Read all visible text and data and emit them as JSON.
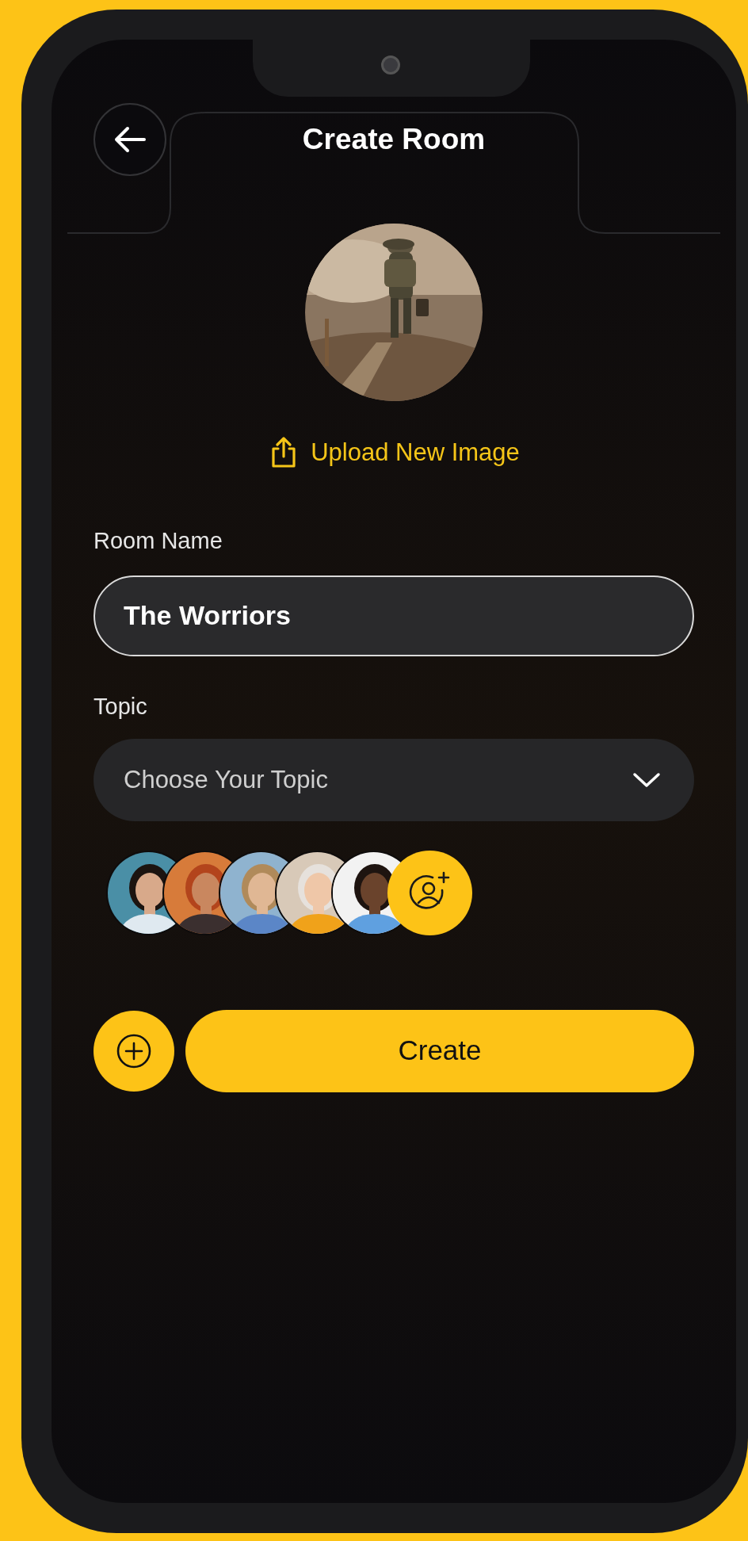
{
  "header": {
    "title": "Create Room"
  },
  "upload_link": "Upload New Image",
  "room_name": {
    "label": "Room Name",
    "value": "The Worriors"
  },
  "topic": {
    "label": "Topic",
    "placeholder": "Choose Your Topic"
  },
  "create_button": "Create"
}
